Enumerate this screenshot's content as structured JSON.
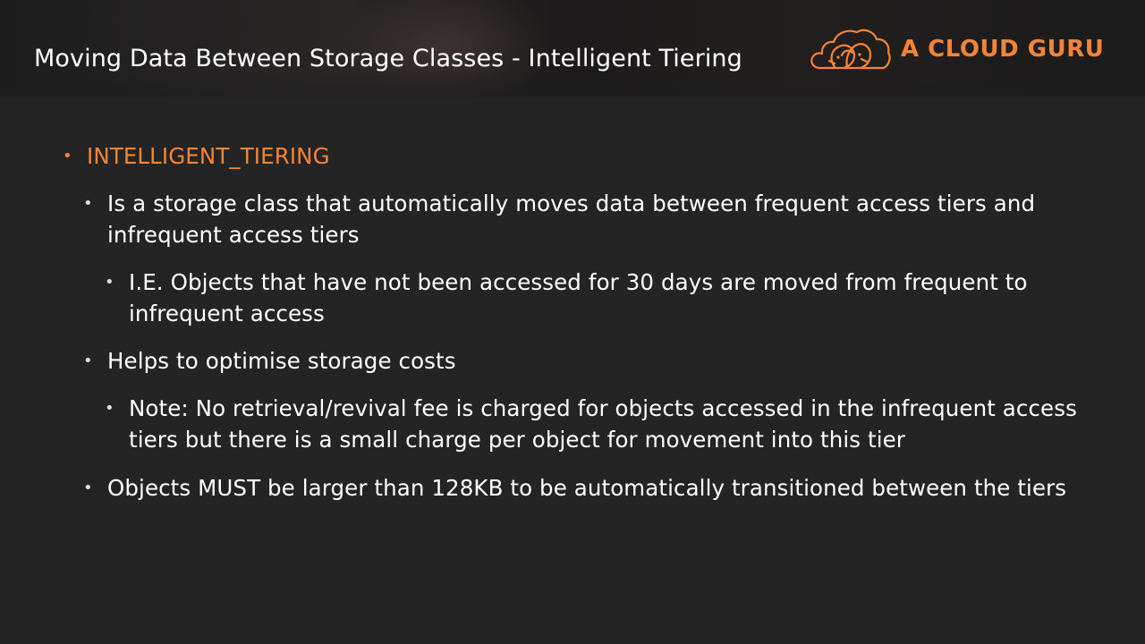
{
  "header": {
    "title": "Moving Data Between Storage Classes - Intelligent Tiering",
    "logo_text": "A CLOUD GURU",
    "logo_icon": "cloud-logo-icon"
  },
  "colors": {
    "accent": "#f58534",
    "background": "#242424",
    "text": "#ffffff"
  },
  "bullets": {
    "b1": "INTELLIGENT_TIERING",
    "b1_1": "Is a storage class that automatically moves data between frequent access tiers and infrequent access tiers",
    "b1_1_1": "I.E. Objects that have not been accessed for 30 days are moved from frequent to infrequent access",
    "b1_2": "Helps to optimise storage costs",
    "b1_2_1": "Note: No retrieval/revival fee is charged for objects accessed in the infrequent access tiers but there is a small charge per object for movement into this tier",
    "b1_3": "Objects MUST be larger than 128KB to be automatically transitioned between the tiers"
  }
}
